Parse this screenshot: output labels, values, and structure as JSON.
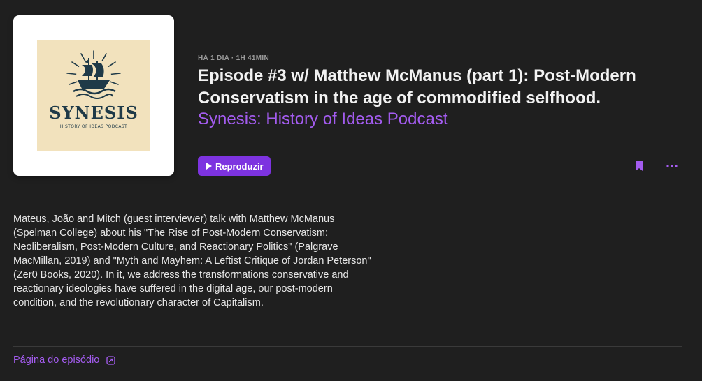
{
  "artwork": {
    "title": "SYNESIS",
    "subtitle": "HISTORY OF IDEAS PODCAST"
  },
  "episode": {
    "meta": "HÁ 1 DIA · 1H 41MIN",
    "title": "Episode #3 w/ Matthew McManus (part 1): Post-Modern Conservatism in the age of commodified selfhood.",
    "show_name": "Synesis: History of Ideas Podcast",
    "description": "Mateus, João and Mitch (guest interviewer) talk with Matthew McManus (Spelman College) about his \"The Rise of Post-Modern Conservatism: Neoliberalism, Post-Modern Culture, and Reactionary Politics\" (Palgrave MacMillan, 2019) and \"Myth and Mayhem: A Leftist Critique of Jordan Peterson\" (Zer0 Books, 2020). In it, we address the transformations conservative and reactionary ideologies have suffered in the digital age, our post-modern condition, and the revolutionary character of Capitalism."
  },
  "actions": {
    "play_label": "Reproduzir",
    "episode_page_label": "Página do episódio"
  },
  "icons": {
    "play": "play-icon",
    "bookmark": "bookmark-icon",
    "more": "more-icon",
    "external_link": "external-link-icon"
  },
  "colors": {
    "background": "#1f1f1f",
    "accent": "#7d33e0",
    "link": "#a45cf0",
    "logo_navy": "#1f3a48",
    "logo_cream": "#f2e2bd"
  }
}
